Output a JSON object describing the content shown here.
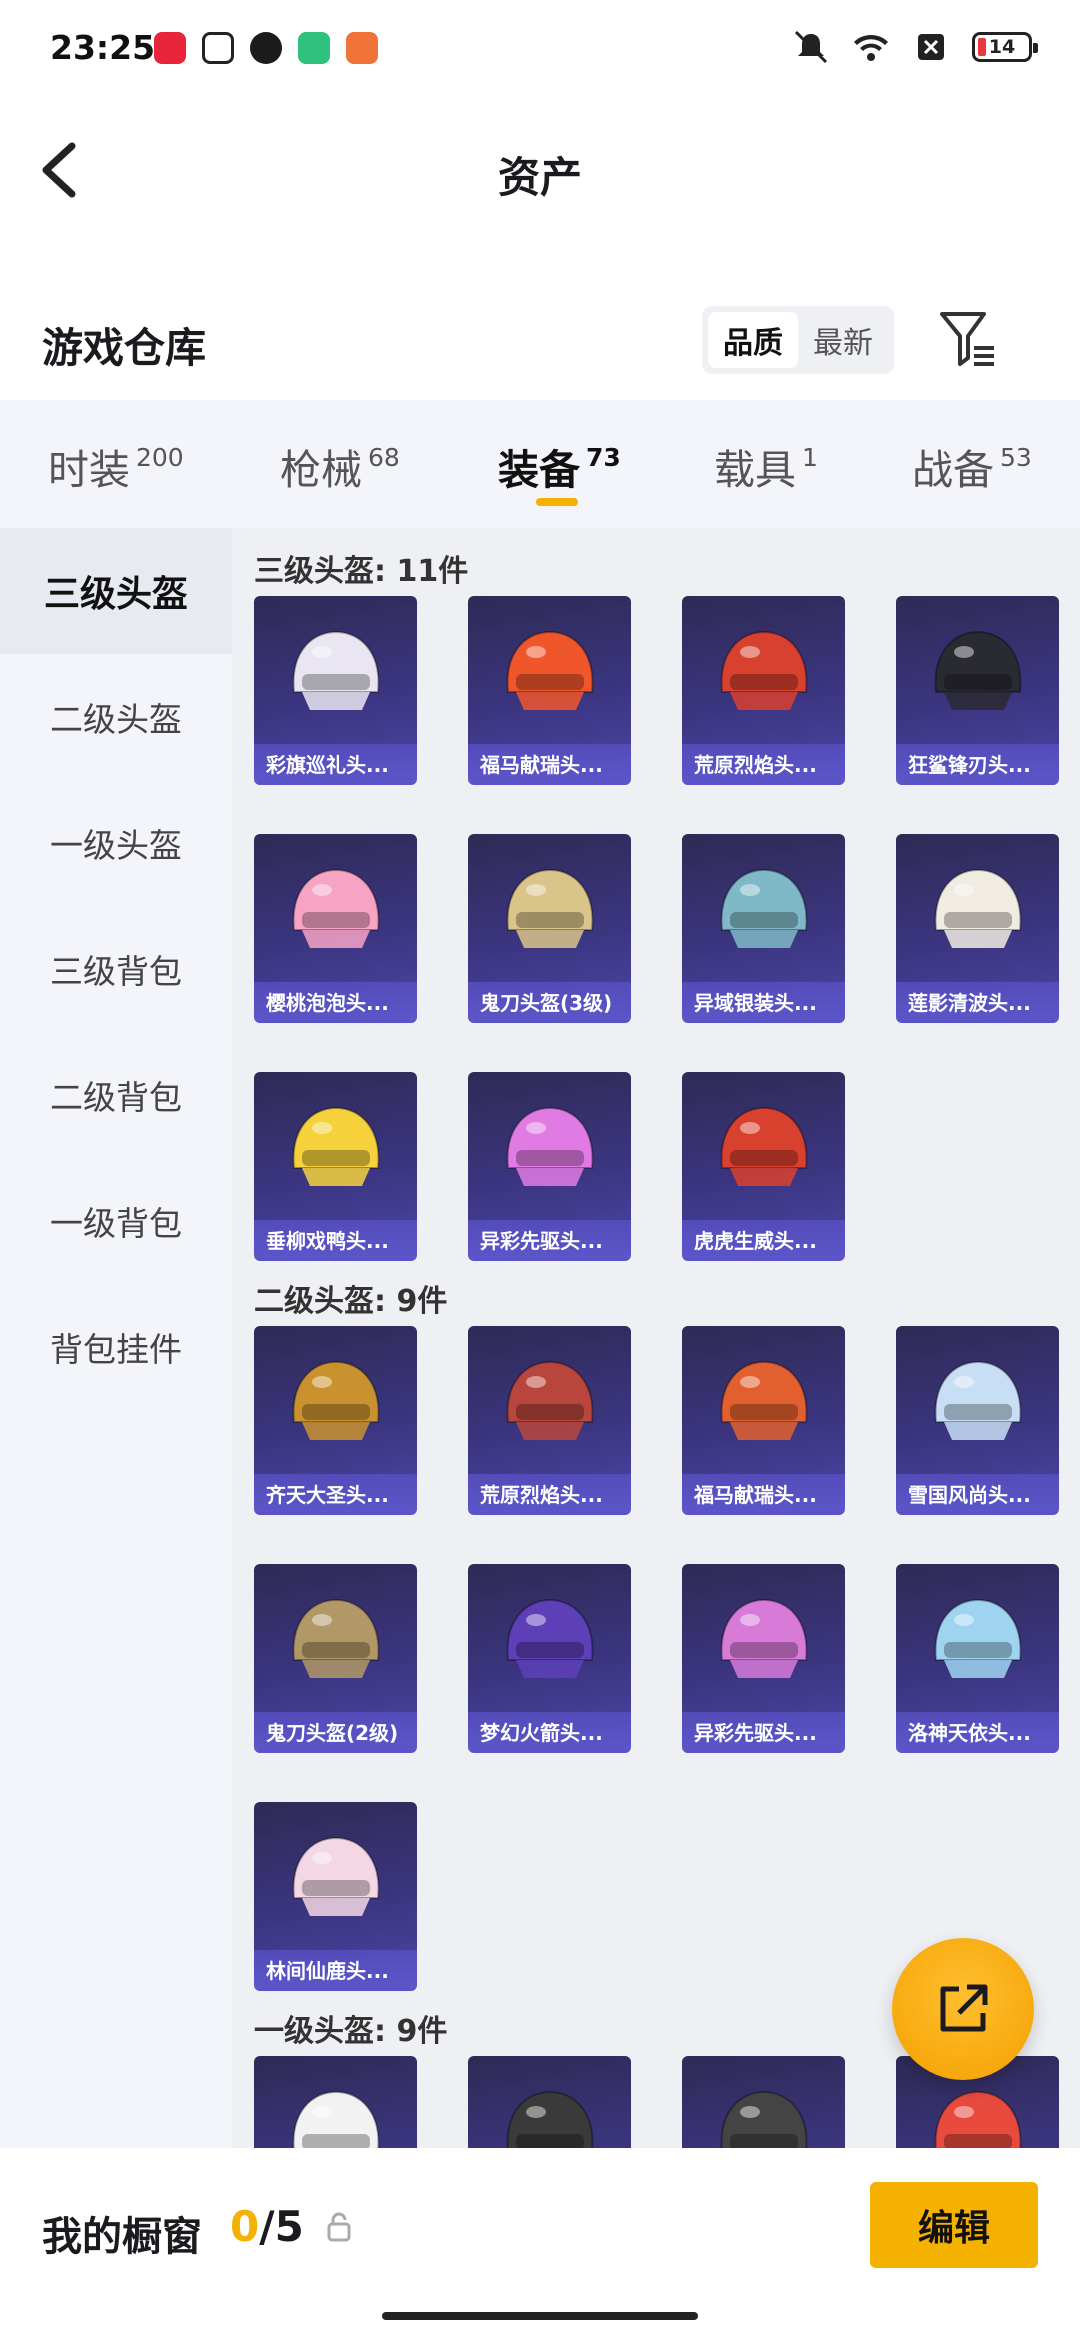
{
  "status_bar": {
    "time": "23:25",
    "battery": "14",
    "icons": [
      "music-app-icon",
      "alipay-icon",
      "shield-app-icon",
      "green-app-icon",
      "orange-app-icon",
      "mute-icon",
      "wifi-icon",
      "sim-off-icon"
    ]
  },
  "header": {
    "title": "资产"
  },
  "warehouse": {
    "title": "游戏仓库",
    "sort_options": [
      "品质",
      "最新"
    ],
    "sort_active": "品质"
  },
  "tabs": [
    {
      "label": "时装",
      "count": "200"
    },
    {
      "label": "枪械",
      "count": "68"
    },
    {
      "label": "装备",
      "count": "73",
      "active": true
    },
    {
      "label": "载具",
      "count": "1"
    },
    {
      "label": "战备",
      "count": "53"
    }
  ],
  "sidenav": [
    "三级头盔",
    "二级头盔",
    "一级头盔",
    "三级背包",
    "二级背包",
    "一级背包",
    "背包挂件"
  ],
  "sections": [
    {
      "title": "三级头盔: 11件",
      "items": [
        "彩旗巡礼头...",
        "福马献瑞头...",
        "荒原烈焰头...",
        "狂鲨锋刃头...",
        "樱桃泡泡头...",
        "鬼刀头盔(3级)",
        "异域银装头...",
        "莲影清波头...",
        "垂柳戏鸭头...",
        "异彩先驱头...",
        "虎虎生威头..."
      ]
    },
    {
      "title": "二级头盔: 9件",
      "items": [
        "齐天大圣头...",
        "荒原烈焰头...",
        "福马献瑞头...",
        "雪国风尚头...",
        "鬼刀头盔(2级)",
        "梦幻火箭头...",
        "异彩先驱头...",
        "洛神天依头...",
        "林间仙鹿头..."
      ]
    },
    {
      "title": "一级头盔: 9件",
      "items": [
        "",
        "",
        "",
        ""
      ]
    }
  ],
  "item_colors": [
    [
      "#e9e6f2",
      "#f0562b",
      "#d8402f",
      "#2a2a33",
      "#f6a3c4",
      "#d9c48a",
      "#7fb9c7",
      "#f1ece2",
      "#f5d23c",
      "#e07be4",
      "#d9412f"
    ],
    [
      "#c9922f",
      "#b8463d",
      "#e2602f",
      "#c7def4",
      "#b39867",
      "#5d3fb8",
      "#d77ad8",
      "#9fd4f0",
      "#f3d7e4"
    ],
    [
      "#f2f2f2",
      "#3a3a3a",
      "#444",
      "#e84a3e"
    ]
  ],
  "bottom": {
    "showcase_label": "我的橱窗",
    "showcase_current": "0",
    "showcase_max": "/5",
    "edit_label": "编辑"
  },
  "accent": "#f5b100"
}
